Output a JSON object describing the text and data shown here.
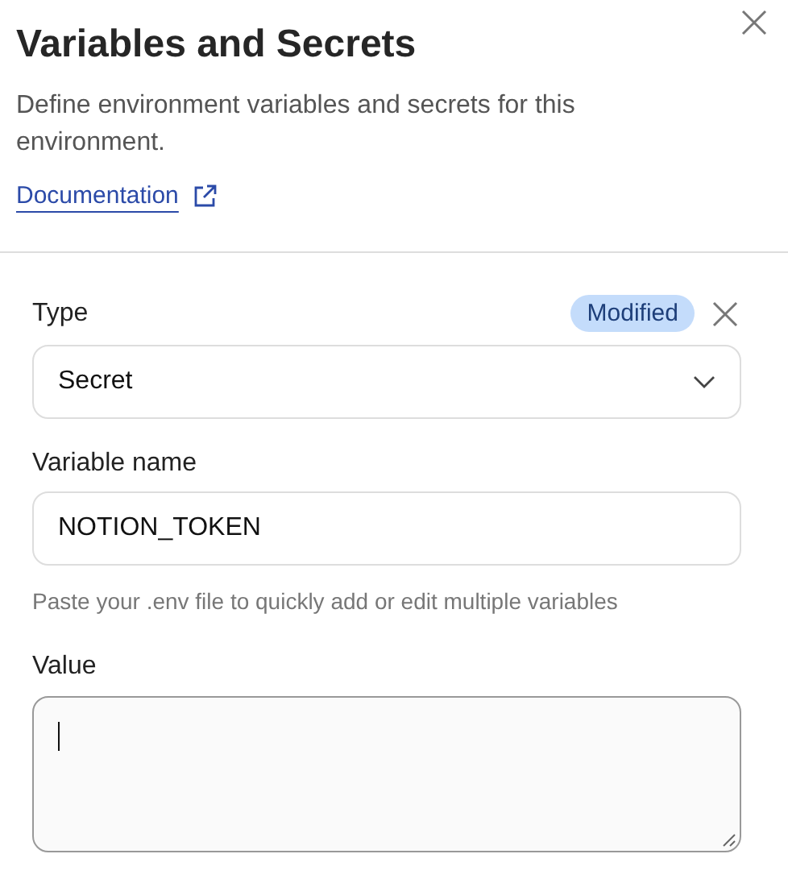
{
  "header": {
    "title": "Variables and Secrets",
    "description": "Define environment variables and secrets for this environment.",
    "link": "Documentation"
  },
  "form": {
    "type_label": "Type",
    "badge": "Modified",
    "type_value": "Secret",
    "name_label": "Variable name",
    "name_value": "NOTION_TOKEN",
    "hint": "Paste your .env file to quickly add or edit multiple variables",
    "value_label": "Value",
    "value_focused": true
  }
}
